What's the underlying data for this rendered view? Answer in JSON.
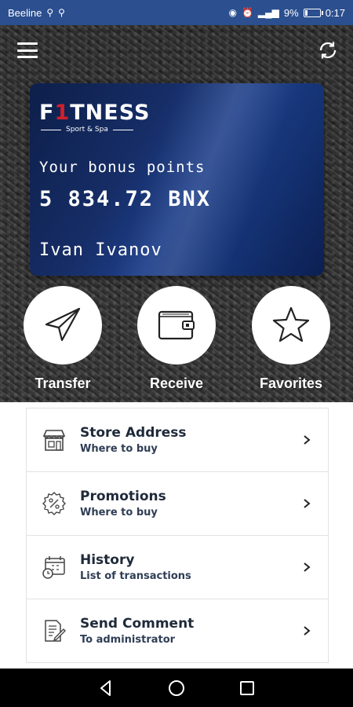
{
  "status_bar": {
    "carrier": "Beeline",
    "battery": "9%",
    "time": "0:17"
  },
  "card": {
    "logo_main_prefix": "F",
    "logo_main_accent": "1",
    "logo_main_suffix": "TNESS",
    "logo_sub": "Sport & Spa",
    "bonus_label": "Your bonus points",
    "bonus_value": "5 834.72 BNX",
    "holder": "Ivan Ivanov"
  },
  "actions": [
    {
      "label": "Transfer",
      "icon": "paper-plane-icon"
    },
    {
      "label": "Receive",
      "icon": "wallet-icon"
    },
    {
      "label": "Favorites",
      "icon": "star-icon"
    }
  ],
  "menu": [
    {
      "title": "Store Address",
      "subtitle": "Where to buy",
      "icon": "store-icon"
    },
    {
      "title": "Promotions",
      "subtitle": "Where to buy",
      "icon": "percent-badge-icon"
    },
    {
      "title": "History",
      "subtitle": "List of transactions",
      "icon": "calendar-clock-icon"
    },
    {
      "title": "Send Comment",
      "subtitle": "To administrator",
      "icon": "edit-document-icon"
    }
  ],
  "colors": {
    "status_bar": "#2b4f8f",
    "card_blue": "#162d66",
    "logo_red": "#d11f2b",
    "text_dark": "#1f2a3a"
  }
}
